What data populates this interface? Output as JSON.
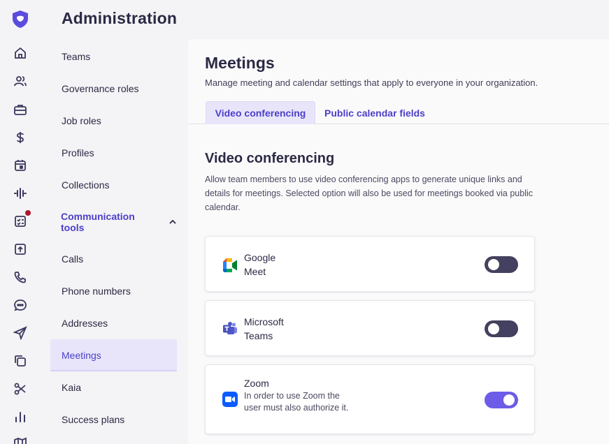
{
  "app": {
    "title": "Administration"
  },
  "rail": {
    "icons": [
      "shield-logo-icon",
      "home-icon",
      "users-icon",
      "briefcase-icon",
      "dollar-icon",
      "calendar-icon",
      "waveform-icon",
      "checklist-icon",
      "upload-icon",
      "phone-icon",
      "chat-icon",
      "send-icon",
      "copy-icon",
      "scissors-icon",
      "bar-chart-icon",
      "map-icon"
    ],
    "notification_color": "#b0162f"
  },
  "subnav": {
    "items_top": [
      "Teams",
      "Governance roles",
      "Job roles",
      "Profiles",
      "Collections"
    ],
    "group_label": "Communication tools",
    "items_group": [
      "Calls",
      "Phone numbers",
      "Addresses",
      "Meetings",
      "Kaia",
      "Success plans"
    ],
    "active": "Meetings"
  },
  "page": {
    "title": "Meetings",
    "subtitle": "Manage meeting and calendar settings that apply to everyone in your organization.",
    "tabs": [
      {
        "label": "Video conferencing",
        "active": true
      },
      {
        "label": "Public calendar fields",
        "active": false
      }
    ]
  },
  "section": {
    "title": "Video conferencing",
    "description": "Allow team members to use video conferencing apps to generate unique links and details for meetings. Selected option will also be used for meetings booked via public calendar."
  },
  "providers": [
    {
      "name_line1": "Google",
      "name_line2": "Meet",
      "icon": "google-meet-icon",
      "enabled": false
    },
    {
      "name_line1": "Microsoft",
      "name_line2": "Teams",
      "icon": "microsoft-teams-icon",
      "enabled": false
    },
    {
      "name_line1": "Zoom",
      "note": "In order to use Zoom the user must also authorize it.",
      "icon": "zoom-icon",
      "enabled": true
    }
  ],
  "colors": {
    "accent": "#4b3fc9",
    "toggle_on": "#6c5ce7",
    "toggle_off": "#43415f",
    "active_bg": "#e8e5fb"
  }
}
